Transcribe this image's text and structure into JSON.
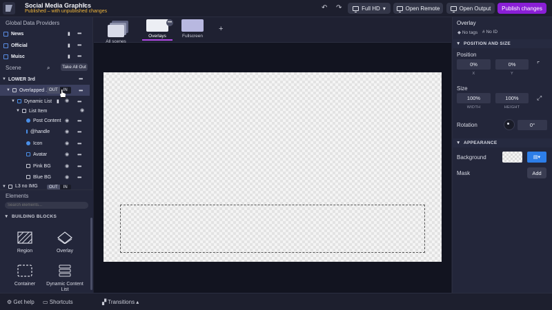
{
  "header": {
    "project_title": "Social Media Graphics",
    "status": "Published – with unpublished changes",
    "resolution_label": "Full HD",
    "open_remote_label": "Open Remote",
    "open_output_label": "Open Output",
    "publish_label": "Publish changes"
  },
  "data_providers": {
    "title": "Global Data Providers",
    "items": [
      {
        "label": "News"
      },
      {
        "label": "Official"
      },
      {
        "label": "Muisc"
      }
    ]
  },
  "scene_panel": {
    "title": "Scene",
    "take_all_label": "Take All Out",
    "tree": [
      {
        "label": "LOWER 3rd"
      },
      {
        "label": "Overlapped ...",
        "out_label": "OUT",
        "in_label": "IN"
      },
      {
        "label": "Dynamic List"
      },
      {
        "label": "List Item"
      },
      {
        "label": "Post Content"
      },
      {
        "label": "@handle"
      },
      {
        "label": "Icon"
      },
      {
        "label": "Avatar"
      },
      {
        "label": "Pink BG"
      },
      {
        "label": "Blue BG"
      },
      {
        "label": "L3 no IMG",
        "out_label": "OUT",
        "in_label": "IN"
      }
    ]
  },
  "elements_panel": {
    "title": "Elements",
    "search_placeholder": "Search elements...",
    "section_title": "BUILDING BLOCKS",
    "blocks": [
      {
        "label": "Region"
      },
      {
        "label": "Overlay"
      },
      {
        "label": "Container"
      },
      {
        "label": "Dynamic Content List"
      }
    ]
  },
  "scenes_bar": {
    "tabs": [
      {
        "label": "All scenes"
      },
      {
        "label": "Overlays"
      },
      {
        "label": "Fullscreen"
      }
    ],
    "add_label": "+"
  },
  "footer": {
    "help_label": "Get help",
    "shortcuts_label": "Shortcuts",
    "transitions_label": "Transitions"
  },
  "inspector": {
    "title": "Overlay",
    "tags_label": "No tags",
    "id_label": "No ID",
    "position_section": "POSITION AND SIZE",
    "position_label": "Position",
    "x_value": "0%",
    "y_value": "0%",
    "x_sub": "X",
    "y_sub": "Y",
    "size_label": "Size",
    "width_value": "100%",
    "height_value": "100%",
    "width_sub": "WIDTH",
    "height_sub": "HEIGHT",
    "rotation_label": "Rotation",
    "rotation_value": "0°",
    "appearance_section": "APPEARANCE",
    "background_label": "Background",
    "mask_label": "Mask",
    "add_label": "Add"
  },
  "colors": {
    "accent": "#8a1fd6",
    "warning": "#f0b63c",
    "info": "#2d7ee8"
  }
}
